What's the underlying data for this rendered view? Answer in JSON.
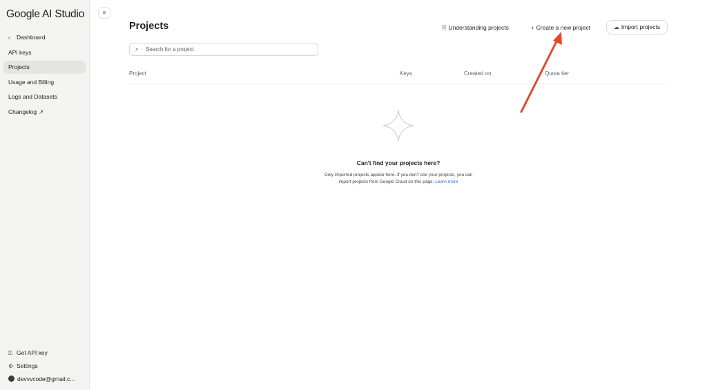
{
  "app": {
    "logo": "Google AI Studio"
  },
  "sidebar": {
    "items": [
      {
        "label": "Dashboard",
        "icon": "chevron-left-icon"
      },
      {
        "label": "API keys"
      },
      {
        "label": "Projects",
        "active": true
      },
      {
        "label": "Usage and Billing"
      },
      {
        "label": "Logs and Datasets"
      },
      {
        "label": "Changelog",
        "icon": "external-link-icon"
      }
    ],
    "bottom": {
      "get_api_key": "Get API key",
      "settings": "Settings",
      "account": "devvvcode@gmail.c..."
    }
  },
  "header": {
    "title": "Projects",
    "understanding_label": "Understanding projects",
    "create_label": "Create a new project",
    "import_label": "Import projects"
  },
  "search": {
    "placeholder": "Search for a project",
    "value": ""
  },
  "table": {
    "columns": [
      "Project",
      "Keys",
      "Created on",
      "Quota tier"
    ]
  },
  "empty_state": {
    "title": "Can't find your projects here?",
    "description_line1": "Only imported projects appear here. If you don't see your projects, you can",
    "description_line2": "import projects from Google Cloud on this page.",
    "link_label": "Learn more"
  },
  "colors": {
    "accent_link": "#1a73e8",
    "annotation_arrow": "#e8452c",
    "sidebar_bg": "#f3f3f1"
  }
}
